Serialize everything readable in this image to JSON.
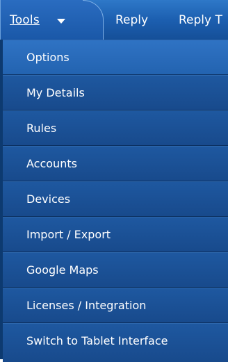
{
  "toolbar": {
    "tools_label": "Tools",
    "reply_label": "Reply",
    "reply_to_label": "Reply T"
  },
  "menu": {
    "items": [
      {
        "label": "Options"
      },
      {
        "label": "My Details"
      },
      {
        "label": "Rules"
      },
      {
        "label": "Accounts"
      },
      {
        "label": "Devices"
      },
      {
        "label": "Import / Export"
      },
      {
        "label": "Google Maps"
      },
      {
        "label": "Licenses / Integration"
      },
      {
        "label": "Switch to Tablet Interface"
      }
    ]
  },
  "colors": {
    "menu_background": "#1a4f93",
    "highlight": "#2f73c4",
    "text": "#ffffff"
  },
  "icons": {
    "tools_dropdown": "chevron-down-icon"
  }
}
